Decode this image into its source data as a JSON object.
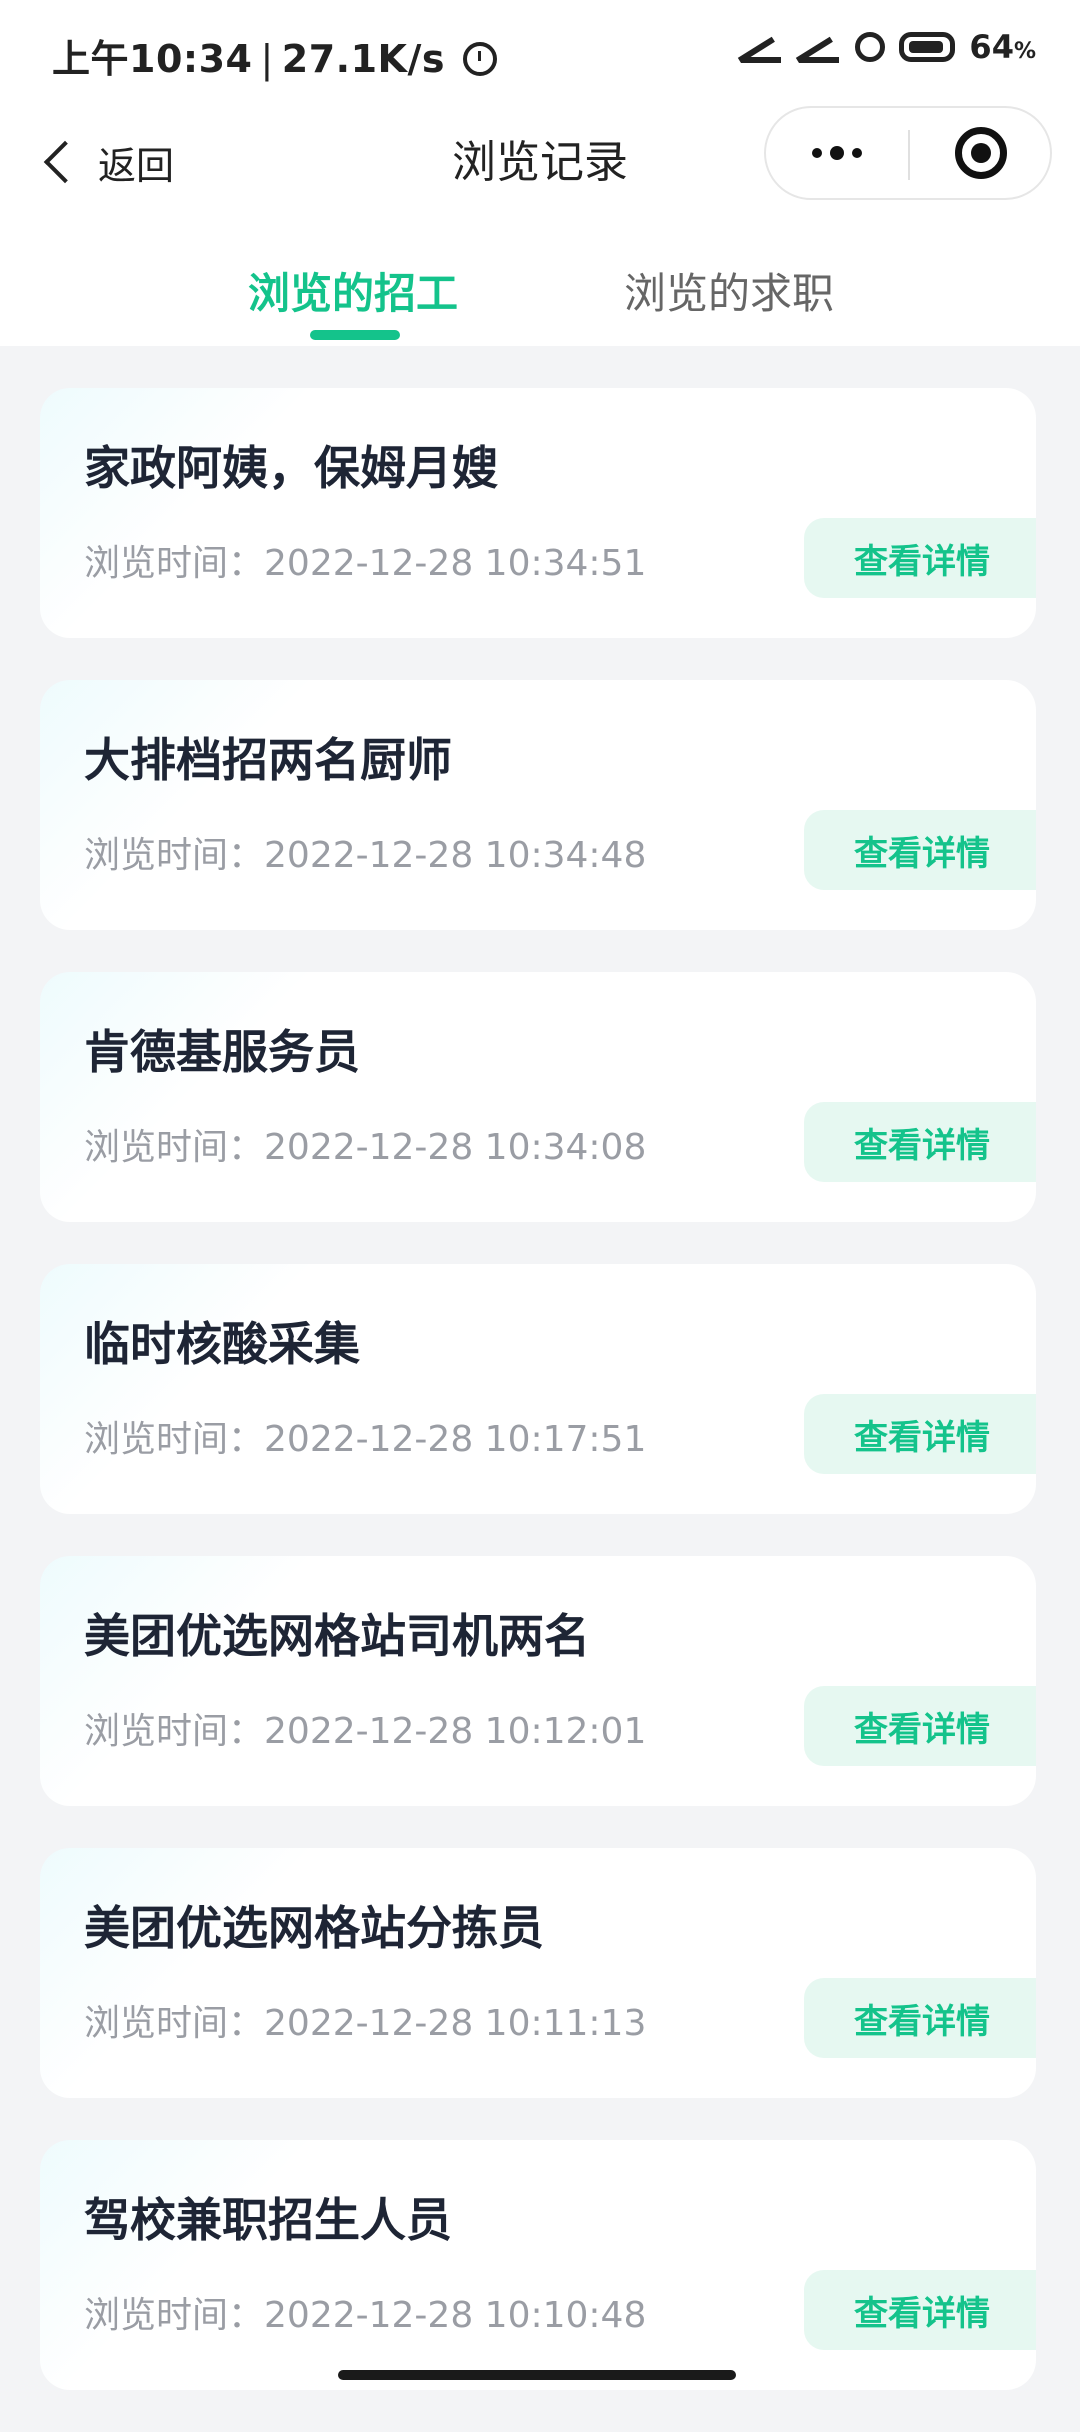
{
  "status_bar": {
    "time": "上午10:34",
    "separator": "|",
    "net_speed": "27.1K/s",
    "battery_level": "64",
    "battery_unit": "%"
  },
  "nav": {
    "back_label": "返回",
    "title": "浏览记录"
  },
  "tabs": [
    {
      "label": "浏览的招工",
      "active": true
    },
    {
      "label": "浏览的求职",
      "active": false
    }
  ],
  "list": {
    "time_label": "浏览时间：",
    "button_label": "查看详情",
    "items": [
      {
        "title": "家政阿姨，保姆月嫂",
        "time": "2022-12-28 10:34:51"
      },
      {
        "title": "大排档招两名厨师",
        "time": "2022-12-28 10:34:48"
      },
      {
        "title": "肯德基服务员",
        "time": "2022-12-28 10:34:08"
      },
      {
        "title": "临时核酸采集",
        "time": "2022-12-28 10:17:51"
      },
      {
        "title": "美团优选网格站司机两名",
        "time": "2022-12-28 10:12:01"
      },
      {
        "title": "美团优选网格站分拣员",
        "time": "2022-12-28 10:11:13"
      },
      {
        "title": "驾校兼职招生人员",
        "time": "2022-12-28 10:10:48"
      }
    ]
  },
  "colors": {
    "accent": "#14c38b",
    "accent_bg": "#e6f8f1",
    "background": "#f3f4f6",
    "title_text": "#1e2535",
    "secondary_text": "#9a9da4"
  }
}
